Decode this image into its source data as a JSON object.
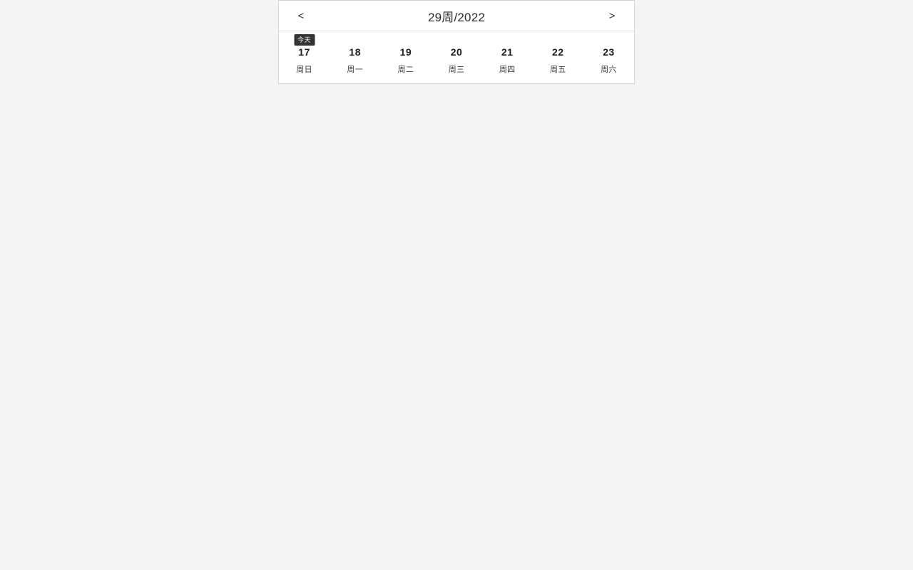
{
  "card": {
    "name": "week-picker",
    "accent_dark": "#333333",
    "background": "#ffffff",
    "page_background": "#f4f4f4",
    "border_color": "#d7d7d7"
  },
  "header": {
    "prev_label": "<",
    "next_label": ">",
    "title": "29周/2022"
  },
  "days": [
    {
      "num": "17",
      "weekday": "周日",
      "badge": "今天",
      "is_today": true
    },
    {
      "num": "18",
      "weekday": "周一",
      "badge": "",
      "is_today": false
    },
    {
      "num": "19",
      "weekday": "周二",
      "badge": "",
      "is_today": false
    },
    {
      "num": "20",
      "weekday": "周三",
      "badge": "",
      "is_today": false
    },
    {
      "num": "21",
      "weekday": "周四",
      "badge": "",
      "is_today": false
    },
    {
      "num": "22",
      "weekday": "周五",
      "badge": "",
      "is_today": false
    },
    {
      "num": "23",
      "weekday": "周六",
      "badge": "",
      "is_today": false
    }
  ]
}
